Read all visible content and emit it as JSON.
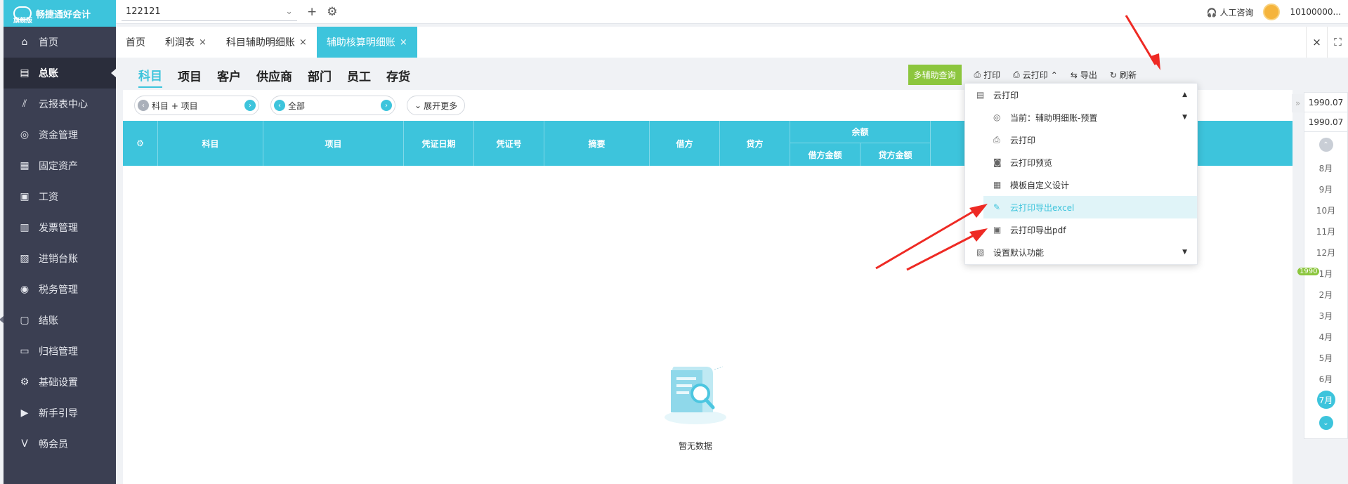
{
  "sidebar": {
    "brand": "畅捷通好会计",
    "edition": "旗舰版",
    "items": [
      {
        "label": "首页",
        "icon": "home-icon"
      },
      {
        "label": "总账",
        "icon": "ledger-icon",
        "active": true
      },
      {
        "label": "云报表中心",
        "icon": "report-icon"
      },
      {
        "label": "资金管理",
        "icon": "money-icon"
      },
      {
        "label": "固定资产",
        "icon": "asset-icon"
      },
      {
        "label": "工资",
        "icon": "salary-icon"
      },
      {
        "label": "发票管理",
        "icon": "invoice-icon"
      },
      {
        "label": "进销台账",
        "icon": "inventory-icon"
      },
      {
        "label": "税务管理",
        "icon": "tax-icon"
      },
      {
        "label": "结账",
        "icon": "closing-icon"
      },
      {
        "label": "归档管理",
        "icon": "archive-icon"
      },
      {
        "label": "基础设置",
        "icon": "gear-icon"
      },
      {
        "label": "新手引导",
        "icon": "guide-icon"
      },
      {
        "label": "畅会员",
        "icon": "vip-icon"
      }
    ]
  },
  "topbar": {
    "company": "122121",
    "support": "人工咨询",
    "user": "10100000..."
  },
  "tabs": [
    {
      "label": "首页",
      "closable": false
    },
    {
      "label": "利润表",
      "closable": true
    },
    {
      "label": "科目辅助明细账",
      "closable": true
    },
    {
      "label": "辅助核算明细账",
      "closable": true,
      "active": true
    }
  ],
  "subtabs": [
    "科目",
    "项目",
    "客户",
    "供应商",
    "部门",
    "员工",
    "存货"
  ],
  "toolbar": {
    "multi_query": "多辅助查询",
    "print": "打印",
    "cloud_print": "云打印",
    "export": "导出",
    "refresh": "刷新"
  },
  "filter": {
    "select1": "科目 + 项目",
    "select2": "全部",
    "expand": "展开更多"
  },
  "table": {
    "headers": [
      "科目",
      "项目",
      "凭证日期",
      "凭证号",
      "摘要",
      "借方",
      "贷方"
    ],
    "balance_group": "余额",
    "balance_sub": [
      "借方金额",
      "贷方金额"
    ]
  },
  "empty_text": "暂无数据",
  "dropdown": {
    "title": "云打印",
    "current": "当前：辅助明细账-预置",
    "items": [
      "云打印",
      "云打印预览",
      "模板自定义设计",
      "云打印导出excel",
      "云打印导出pdf"
    ],
    "default": "设置默认功能"
  },
  "right_panel": {
    "dates": [
      "1990.07",
      "1990.07"
    ],
    "year_badge": "1990",
    "months": [
      "8月",
      "9月",
      "10月",
      "11月",
      "12月",
      "1月",
      "2月",
      "3月",
      "4月",
      "5月",
      "6月",
      "7月"
    ],
    "active_month": "7月"
  },
  "colors": {
    "accent": "#3dc4dc",
    "sidebar": "#3b3f52",
    "green": "#8cc63e",
    "arrow": "#ee2a24"
  }
}
